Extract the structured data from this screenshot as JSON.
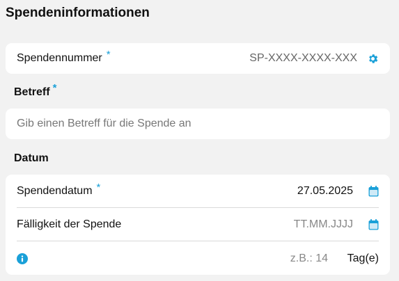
{
  "page": {
    "title": "Spendeninformationen"
  },
  "donation_number": {
    "label": "Spendennummer",
    "required_mark": "*",
    "value": "SP-XXXX-XXXX-XXX"
  },
  "subject": {
    "label": "Betreff",
    "required_mark": "*",
    "placeholder": "Gib einen Betreff für die Spende an"
  },
  "date_section": {
    "label": "Datum",
    "donation_date": {
      "label": "Spendendatum",
      "required_mark": "*",
      "value": "27.05.2025"
    },
    "due_date": {
      "label": "Fälligkeit der Spende",
      "placeholder": "TT.MM.JJJJ"
    },
    "days": {
      "placeholder": "z.B.: 14",
      "unit": "Tag(e)"
    }
  },
  "colors": {
    "accent": "#1aa0d8",
    "card": "#ffffff",
    "background": "#f2f2f2"
  },
  "icons": {
    "settings": "gear-icon",
    "calendar": "calendar-icon",
    "info": "info-icon"
  }
}
